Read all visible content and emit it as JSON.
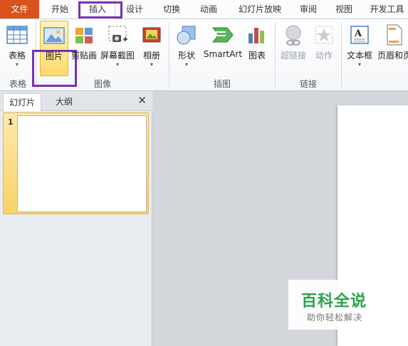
{
  "tabs": [
    {
      "label": "文件"
    },
    {
      "label": "开始"
    },
    {
      "label": "插入"
    },
    {
      "label": "设计"
    },
    {
      "label": "切换"
    },
    {
      "label": "动画"
    },
    {
      "label": "幻灯片放映"
    },
    {
      "label": "审阅"
    },
    {
      "label": "视图"
    },
    {
      "label": "开发工具"
    }
  ],
  "ribbon": {
    "groups": [
      {
        "label": "表格"
      },
      {
        "label": "图像"
      },
      {
        "label": "插图"
      },
      {
        "label": "链接"
      }
    ],
    "buttons": {
      "table": "表格",
      "picture": "图片",
      "clipart": "剪贴画",
      "screenshot": "屏幕截图",
      "album": "相册",
      "shapes": "形状",
      "smartart": "SmartArt",
      "chart": "图表",
      "hyperlink": "超链接",
      "action": "动作",
      "textbox": "文本框",
      "header_footer": "页眉和页"
    },
    "arrow": "▾"
  },
  "pane": {
    "tabs": [
      "幻灯片",
      "大纲"
    ],
    "close": "✕",
    "slide_number": "1"
  },
  "watermark": {
    "title": "百科全说",
    "subtitle": "助你轻松解决"
  },
  "colors": {
    "file_tab": "#d9541d",
    "highlight_box": "#7a2fb0",
    "selected_button": "#ffd96b",
    "watermark_green": "#2da14a"
  }
}
